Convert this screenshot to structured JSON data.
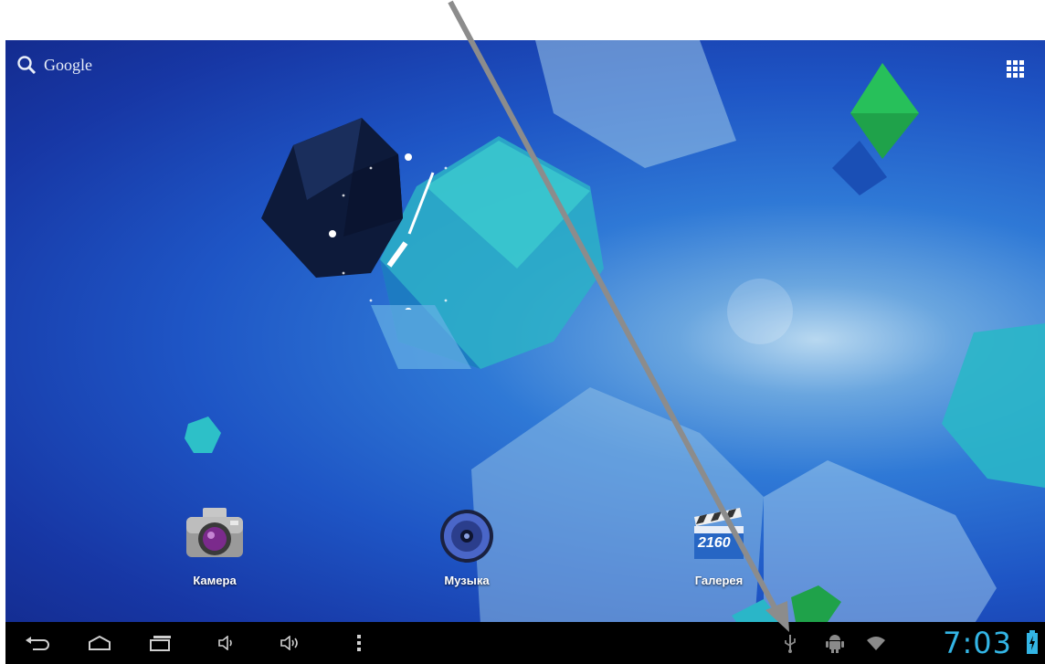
{
  "search": {
    "label": "Google",
    "icon": "search-icon"
  },
  "apps_button": {
    "icon": "all-apps-grid-icon"
  },
  "shortcuts": [
    {
      "label": "Камера",
      "icon": "camera-icon"
    },
    {
      "label": "Музыка",
      "icon": "music-speaker-icon"
    },
    {
      "label": "Галерея",
      "icon": "gallery-clapper-icon"
    }
  ],
  "gallery_icon_text": "2160",
  "navbar": {
    "buttons": [
      {
        "icon": "back-icon"
      },
      {
        "icon": "home-icon"
      },
      {
        "icon": "recent-apps-icon"
      },
      {
        "icon": "volume-down-icon"
      },
      {
        "icon": "volume-up-icon"
      },
      {
        "icon": "menu-overflow-icon"
      }
    ],
    "status": {
      "icons": [
        "usb-icon",
        "android-debug-icon",
        "wifi-icon"
      ],
      "time": "7:03",
      "battery_icon": "battery-charging-icon"
    }
  },
  "colors": {
    "status_accent": "#33b5e5",
    "navbar_bg": "#000000",
    "annotation_arrow": "#8c8c8c"
  }
}
